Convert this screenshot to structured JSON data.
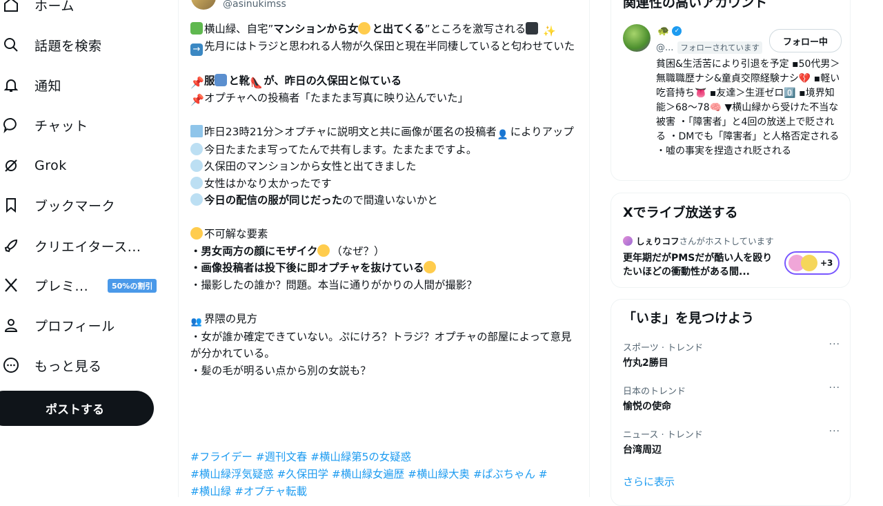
{
  "nav": {
    "home": "ホーム",
    "explore": "話題を検索",
    "notifications": "通知",
    "chat": "チャット",
    "grok": "Grok",
    "bookmarks": "ブックマーク",
    "creator_studio": "クリエイタース...",
    "premium": "プレミ...",
    "premium_badge": "50%の割引",
    "profile": "プロフィール",
    "more": "もっと見る",
    "post_button": "ポストする"
  },
  "post": {
    "handle": "@asinukimss",
    "lines": {
      "l1a": "横山緑、自宅”",
      "l1b": "マンションから女",
      "l1c": "と出てくる",
      "l1d": "”ところを激写される",
      "l2": "先月にはトラジと思われる人物が久保田と現在半同棲していると匂わせていた",
      "l3a": "服",
      "l3b": "と靴",
      "l3c": "が、昨日の久保田と似ている",
      "l4": "オプチャへの投稿者「たまたま写真に映り込んでいた」",
      "l5a": "昨日23時21分＞オプチャに説明文と共に画像が匿名の投稿者",
      "l5b": "によりアップ",
      "l6": "今日たまたま写ってたんで共有します。たまたまですよ。",
      "l7": "久保田のマンションから女性と出てきました",
      "l8": "女性はかなり太かったです",
      "l9a": "今日の配信の服が同じだった",
      "l9b": "ので間違いないかと",
      "l10": "不可解な要素",
      "l11a": "・",
      "l11b": "男女両方の顔にモザイク",
      "l11c": "（なぜ？）",
      "l12a": "・",
      "l12b": "画像投稿者は投下後に即オプチャを抜けている",
      "l13": "・撮影したの誰か？問題。本当に通りがかりの人間が撮影？",
      "l14": "界隈の見方",
      "l15": "・女が誰か確定できていない。ぷにけろ？トラジ？オプチャの部屋によって意見が分かれている。",
      "l16": "・髪の毛が明るい点から別の女説も？"
    },
    "hashtags": [
      "#フライデー",
      "#週刊文春",
      "#横山緑第5の女疑惑",
      "#横山緑浮気疑惑",
      "#久保田学",
      "#横山緑女遍歴",
      "#横山緑大奥",
      "#ぱぶちゃん",
      "#横山緑",
      "#オプチャ転載"
    ]
  },
  "related": {
    "title": "関連性の高いアカウント",
    "handle": "@...",
    "follows_you": "フォローされています",
    "follow_button": "フォロー中",
    "bio": "貧困&生活苦により引退を予定 ▪50代男＞無職職歴ナシ&童貞交際経験ナシ💔 ▪軽い吃音持ち👅 ▪友達＞生涯ゼロ0️⃣ ▪境界知能＞68〜78🧠 ▼横山緑から受けた不当な被害 ・「障害者」と4回の放送上で貶される ・DMでも「障害者」と人格否定される ・嘘の事実を捏造され貶される"
  },
  "live": {
    "title": "Xでライブ放送する",
    "host_name": "しぇりコフ",
    "host_suffix": "さんがホストしています",
    "space_title": "更年期だがPMSだが酷い人を殴りたいほどの衝動性がある間...",
    "extra_count": "+3"
  },
  "trends": {
    "title": "「いま」を見つけよう",
    "items": [
      {
        "category": "スポーツ · トレンド",
        "name": "竹丸2勝目"
      },
      {
        "category": "日本のトレンド",
        "name": "愉悦の使命"
      },
      {
        "category": "ニュース · トレンド",
        "name": "台湾周辺"
      }
    ],
    "more_dots": "···",
    "show_more": "さらに表示"
  },
  "colors": {
    "accent": "#1d9bf0",
    "text": "#0f1419",
    "muted": "#536471",
    "badge": "#4a99e9",
    "live_ring": "#7856ff"
  }
}
